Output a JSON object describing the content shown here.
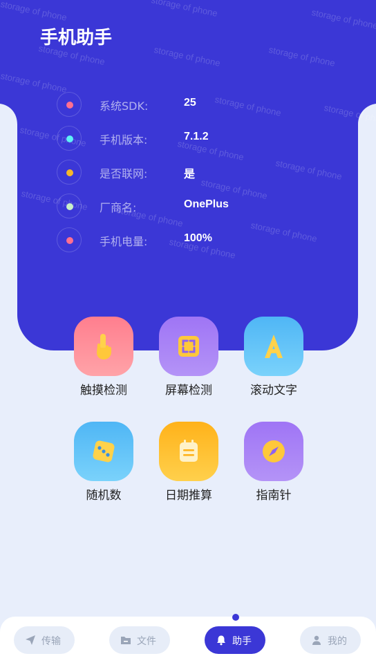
{
  "app": {
    "title": "手机助手",
    "watermark_text": "storage of phone"
  },
  "device_info": [
    {
      "label": "系统SDK:",
      "value": "25",
      "dot_color": "#ff6f91"
    },
    {
      "label": "手机版本:",
      "value": "7.1.2",
      "dot_color": "#5ef0f6"
    },
    {
      "label": "是否联网:",
      "value": "是",
      "dot_color": "#f5b72a"
    },
    {
      "label": "厂商名:",
      "value": "OnePlus",
      "dot_color": "#c9f0c8"
    },
    {
      "label": "手机电量:",
      "value": "100%",
      "dot_color": "#ff6f91"
    }
  ],
  "tools": [
    {
      "label": "触摸检测",
      "icon": "touch-hand-icon"
    },
    {
      "label": "屏幕检测",
      "icon": "screen-frame-icon"
    },
    {
      "label": "滚动文字",
      "icon": "letter-a-icon"
    },
    {
      "label": "随机数",
      "icon": "dice-icon"
    },
    {
      "label": "日期推算",
      "icon": "calendar-icon"
    },
    {
      "label": "指南针",
      "icon": "compass-icon"
    }
  ],
  "tabs": [
    {
      "label": "传输",
      "icon": "paper-plane-icon",
      "active": false
    },
    {
      "label": "文件",
      "icon": "folder-icon",
      "active": false
    },
    {
      "label": "助手",
      "icon": "bell-icon",
      "active": true
    },
    {
      "label": "我的",
      "icon": "user-icon",
      "active": false
    }
  ],
  "colors": {
    "primary": "#3b37d6",
    "background": "#e8eefb"
  }
}
